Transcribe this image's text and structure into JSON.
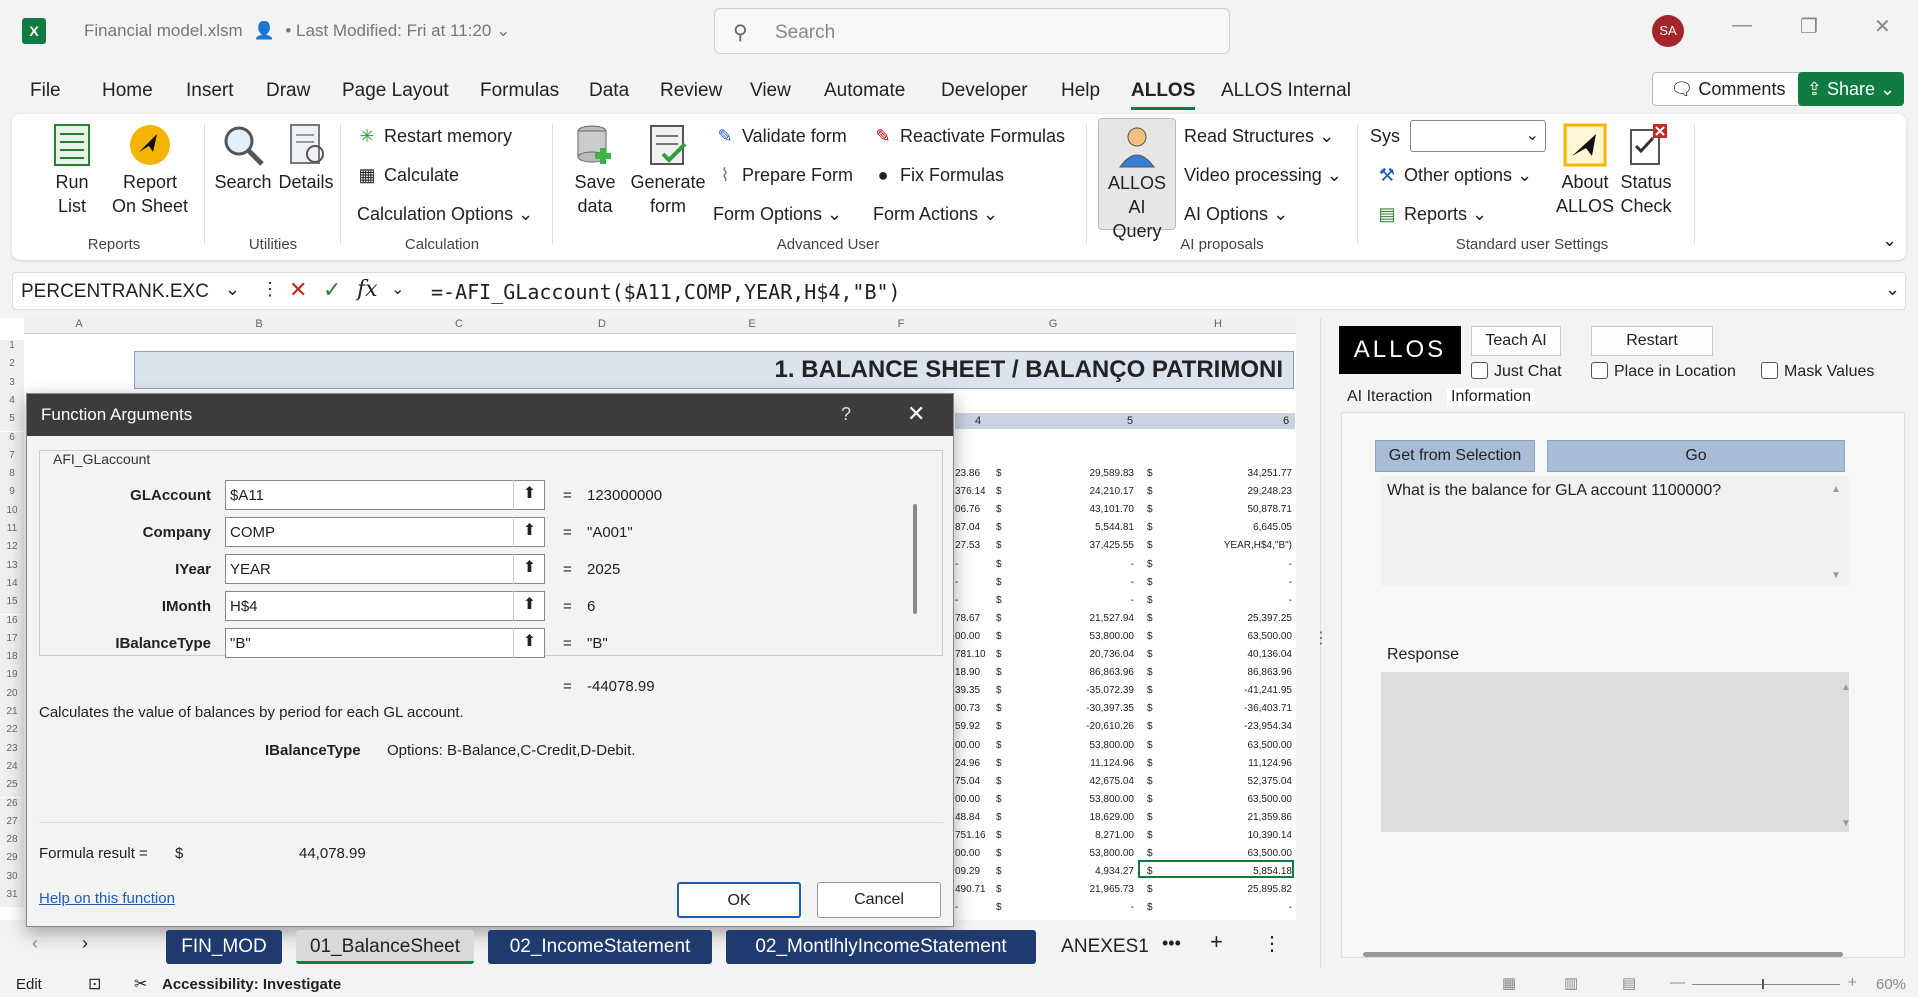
{
  "title_bar": {
    "file_name": "Financial model.xlsm",
    "modified": "• Last Modified: Fri at 11:20",
    "search_placeholder": "Search",
    "user_initials": "SA",
    "app_icon_letter": "X"
  },
  "menu": {
    "tabs": [
      "File",
      "Home",
      "Insert",
      "Draw",
      "Page Layout",
      "Formulas",
      "Data",
      "Review",
      "View",
      "Automate",
      "Developer",
      "Help",
      "ALLOS",
      "ALLOS Internal"
    ],
    "active": "ALLOS",
    "comments": "Comments",
    "share": "Share"
  },
  "ribbon": {
    "run_list": "Run List",
    "report_on_sheet": "Report On Sheet",
    "group_reports": "Reports",
    "search": "Search",
    "details": "Details",
    "group_utilities": "Utilities",
    "restart_memory": "Restart memory",
    "calculate": "Calculate",
    "calculation_options": "Calculation Options",
    "group_calculation": "Calculation",
    "save_data": "Save data",
    "generate_form": "Generate form",
    "validate_form": "Validate form",
    "prepare_form": "Prepare Form",
    "form_options": "Form Options",
    "reactivate_formulas": "Reactivate Formulas",
    "fix_formulas": "Fix Formulas",
    "form_actions": "Form Actions",
    "group_advanced_user": "Advanced User",
    "allos_ai_query": "ALLOS AI Query",
    "read_structures": "Read Structures",
    "video_processing": "Video processing",
    "ai_options": "AI Options",
    "group_ai_proposals": "AI proposals",
    "sys": "Sys",
    "other_options": "Other options",
    "reports": "Reports",
    "about_allos": "About ALLOS",
    "status_check": "Status Check",
    "group_standard_user_settings": "Standard user Settings"
  },
  "formula_bar": {
    "name_box": "PERCENTRANK.EXC",
    "fx": "fx",
    "formula": "=-AFI_GLaccount($A11,COMP,YEAR,H$4,\"B\")"
  },
  "grid": {
    "columns": [
      "A",
      "B",
      "C",
      "D",
      "E",
      "F",
      "G",
      "H"
    ],
    "rows": [
      "1",
      "2",
      "3",
      "4",
      "5",
      "6",
      "7",
      "8",
      "9",
      "10",
      "11",
      "12",
      "13",
      "14",
      "15",
      "16",
      "17",
      "18",
      "19",
      "20",
      "21",
      "22",
      "23",
      "24",
      "25",
      "26",
      "27",
      "28",
      "29",
      "30",
      "31"
    ],
    "title": "1. BALANCE SHEET / BALANÇO PATRIMONI",
    "period_headers": [
      "4",
      "5",
      "6"
    ],
    "col_f": [
      "23.86",
      "376.14",
      "06.76",
      "87.04",
      "27.53",
      "-",
      "-",
      "-",
      "78.67",
      "00.00",
      "781.10",
      "18.90",
      "39.35",
      "00.73",
      "59.92",
      "00.00",
      "24.96",
      "75.04",
      "00.00",
      "48.84",
      "751.16",
      "00.00",
      "09.29",
      "490.71",
      "-"
    ],
    "col_g": [
      "29,589.83",
      "24,210.17",
      "43,101.70",
      "5,544.81",
      "37,425.55",
      "-",
      "-",
      "-",
      "21,527.94",
      "53,800.00",
      "20,736.04",
      "86,863.96",
      "-35,072.39",
      "-30,397.35",
      "-20,610.26",
      "53,800.00",
      "11,124.96",
      "42,675.04",
      "53,800.00",
      "18,629.00",
      "8,271.00",
      "53,800.00",
      "4,934.27",
      "21,965.73",
      "-"
    ],
    "col_h": [
      "34,251.77",
      "29,248.23",
      "50,878.71",
      "6,645.05",
      "YEAR,H$4,\"B\")",
      "-",
      "-",
      "-",
      "25,397.25",
      "63,500.00",
      "40,136.04",
      "86,863.96",
      "-41,241.95",
      "-36,403.71",
      "-23,954.34",
      "63,500.00",
      "11,124.96",
      "52,375.04",
      "63,500.00",
      "21,359.86",
      "10,390.14",
      "63,500.00",
      "5,854.18",
      "25,895.82",
      "-"
    ],
    "currency": "$"
  },
  "dialog": {
    "title": "Function Arguments",
    "help_glyph": "?",
    "function_name": "AFI_GLaccount",
    "args": [
      {
        "label": "GLAccount",
        "input": "$A11",
        "value": "123000000"
      },
      {
        "label": "Company",
        "input": "COMP",
        "value": "\"A001\""
      },
      {
        "label": "IYear",
        "input": "YEAR",
        "value": "2025"
      },
      {
        "label": "IMonth",
        "input": "H$4",
        "value": "6"
      },
      {
        "label": "IBalanceType",
        "input": "\"B\"",
        "value": "\"B\""
      }
    ],
    "eq": "=",
    "total_value": "-44078.99",
    "description": "Calculates the value of balances by period for each GL account.",
    "param_name": "IBalanceType",
    "param_desc": "Options: B-Balance,C-Credit,D-Debit.",
    "formula_result_label": "Formula result =",
    "formula_result_currency": "$",
    "formula_result_value": "44,078.99",
    "help_link": "Help on this function",
    "ok": "OK",
    "cancel": "Cancel"
  },
  "sheet_tabs": [
    "FIN_MOD",
    "01_BalanceSheet",
    "02_IncomeStatement",
    "02_MontlhlyIncomeStatement",
    "ANEXES1"
  ],
  "active_sheet": "01_BalanceSheet",
  "status_bar": {
    "mode": "Edit",
    "accessibility": "Accessibility: Investigate",
    "zoom": "60%"
  },
  "pane": {
    "logo": "ALLOS",
    "teach_ai": "Teach AI",
    "restart": "Restart",
    "just_chat": "Just Chat",
    "place_in_location": "Place in Location",
    "mask_values": "Mask Values",
    "tab_ai_interaction": "AI Iteraction",
    "tab_information": "Information",
    "get_from_selection": "Get from Selection",
    "go": "Go",
    "query": "What is the balance for GLA account 1100000?",
    "response_label": "Response"
  },
  "colors": {
    "excel_green": "#107c41",
    "dialog_title": "#3c3c3c",
    "sheet_tab_navy": "#1f3a6e",
    "allos_blue": "#a9bcd6"
  }
}
